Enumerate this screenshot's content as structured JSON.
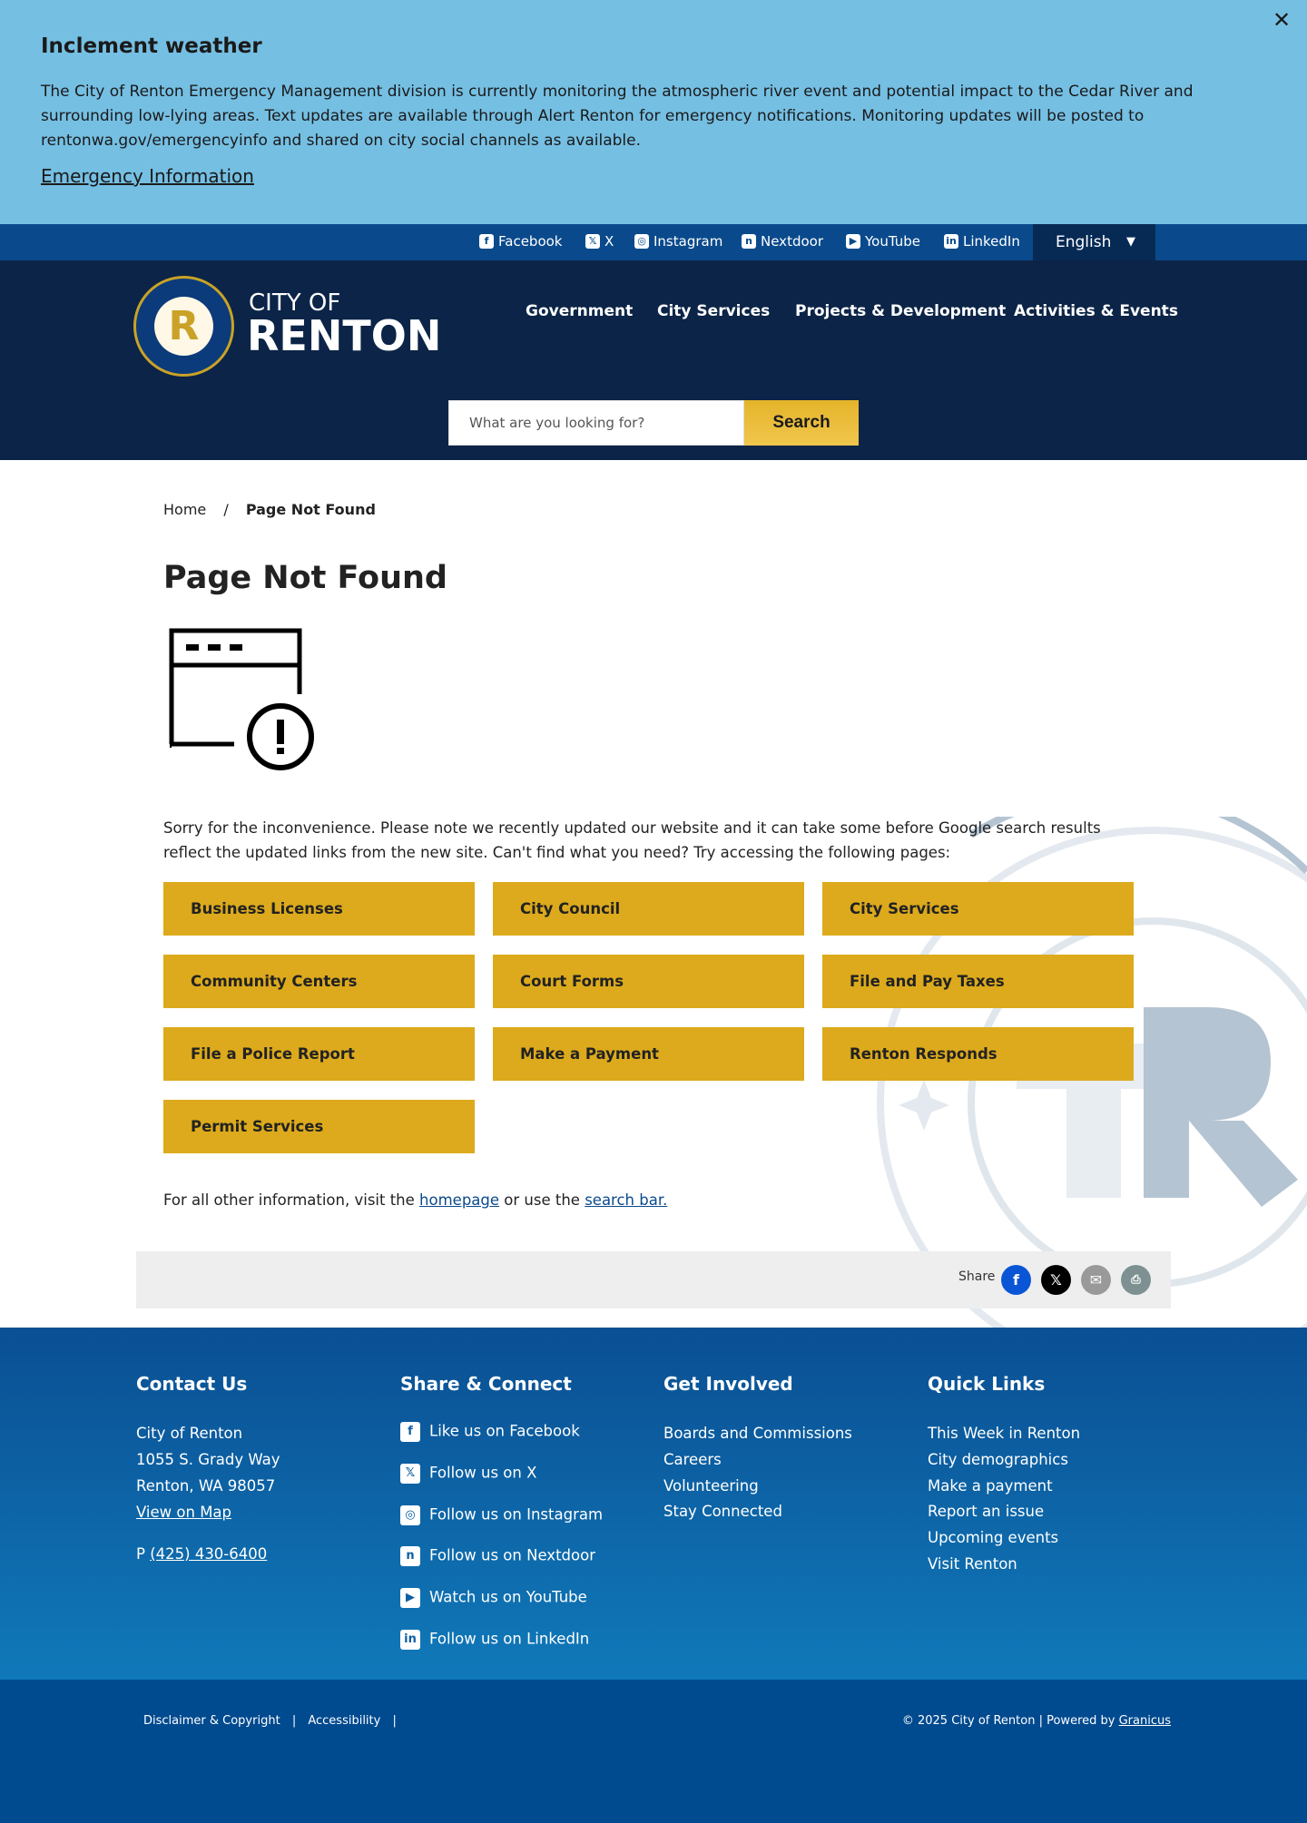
{
  "alert": {
    "title": "Inclement weather",
    "body": "The City of Renton Emergency Management division is currently monitoring the atmospheric river event and potential impact to the Cedar River and surrounding low-lying areas. Text updates are available through Alert Renton for emergency notifications. Monitoring updates will be posted to rentonwa.gov/emergencyinfo and shared on city social channels as available.",
    "link": "Emergency Information",
    "close": "✕"
  },
  "social": [
    {
      "label": "Facebook",
      "icon": "f"
    },
    {
      "label": "X",
      "icon": "𝕏"
    },
    {
      "label": "Instagram",
      "icon": "◎"
    },
    {
      "label": "Nextdoor",
      "icon": "n"
    },
    {
      "label": "YouTube",
      "icon": "▶"
    },
    {
      "label": "LinkedIn",
      "icon": "in"
    }
  ],
  "language": {
    "selected": "English",
    "arrow": "▼"
  },
  "header": {
    "logo_city_of": "CITY OF",
    "logo_renton": "RENTON",
    "logo_mark": "R",
    "nav": [
      "Government",
      "City Services",
      "Projects & Development",
      "Activities & Events"
    ]
  },
  "search": {
    "placeholder": "What are you looking for?",
    "button": "Search"
  },
  "breadcrumb": {
    "home": "Home",
    "sep": "/",
    "current": "Page Not Found"
  },
  "page": {
    "title": "Page Not Found",
    "intro": "Sorry for the inconvenience. Please note we recently updated our website and it can take some before Google search results reflect the updated links from the new site. Can't find what you need? Try accessing the following pages:",
    "links": [
      "Business Licenses",
      "City Council",
      "City Services",
      "Community Centers",
      "Court Forms",
      "File and Pay Taxes",
      "File a Police Report",
      "Make a Payment",
      "Renton Responds",
      "Permit Services"
    ],
    "other_prefix": "For all other information, visit the ",
    "other_home": "homepage",
    "other_mid": " or use the ",
    "other_search": "search bar."
  },
  "share": {
    "label": "Share"
  },
  "footer": {
    "contact": {
      "title": "Contact Us",
      "lines": [
        "City of Renton",
        "1055 S. Grady Way",
        "Renton, WA 98057"
      ],
      "map": "View on Map",
      "phone_prefix": "P ",
      "phone": "(425) 430-6400"
    },
    "connect": {
      "title": "Share & Connect",
      "items": [
        {
          "label": "Like us on Facebook",
          "icon": "f"
        },
        {
          "label": "Follow us on X",
          "icon": "𝕏"
        },
        {
          "label": "Follow us on Instagram",
          "icon": "◎"
        },
        {
          "label": "Follow us on Nextdoor",
          "icon": "n"
        },
        {
          "label": "Watch us on YouTube",
          "icon": "▶"
        },
        {
          "label": "Follow us on LinkedIn",
          "icon": "in"
        }
      ]
    },
    "involved": {
      "title": "Get Involved",
      "items": [
        "Boards and Commissions",
        "Careers",
        "Volunteering",
        "Stay Connected"
      ]
    },
    "quick": {
      "title": "Quick Links",
      "items": [
        "This Week in Renton",
        "City demographics",
        "Make a payment",
        "Report an issue",
        "Upcoming events",
        "Visit Renton"
      ]
    }
  },
  "bottom": {
    "disclaimer": "Disclaimer & Copyright",
    "accessibility": "Accessibility",
    "sep": "|",
    "copyright": "© 2025 City of Renton | Powered by ",
    "granicus": "Granicus"
  }
}
